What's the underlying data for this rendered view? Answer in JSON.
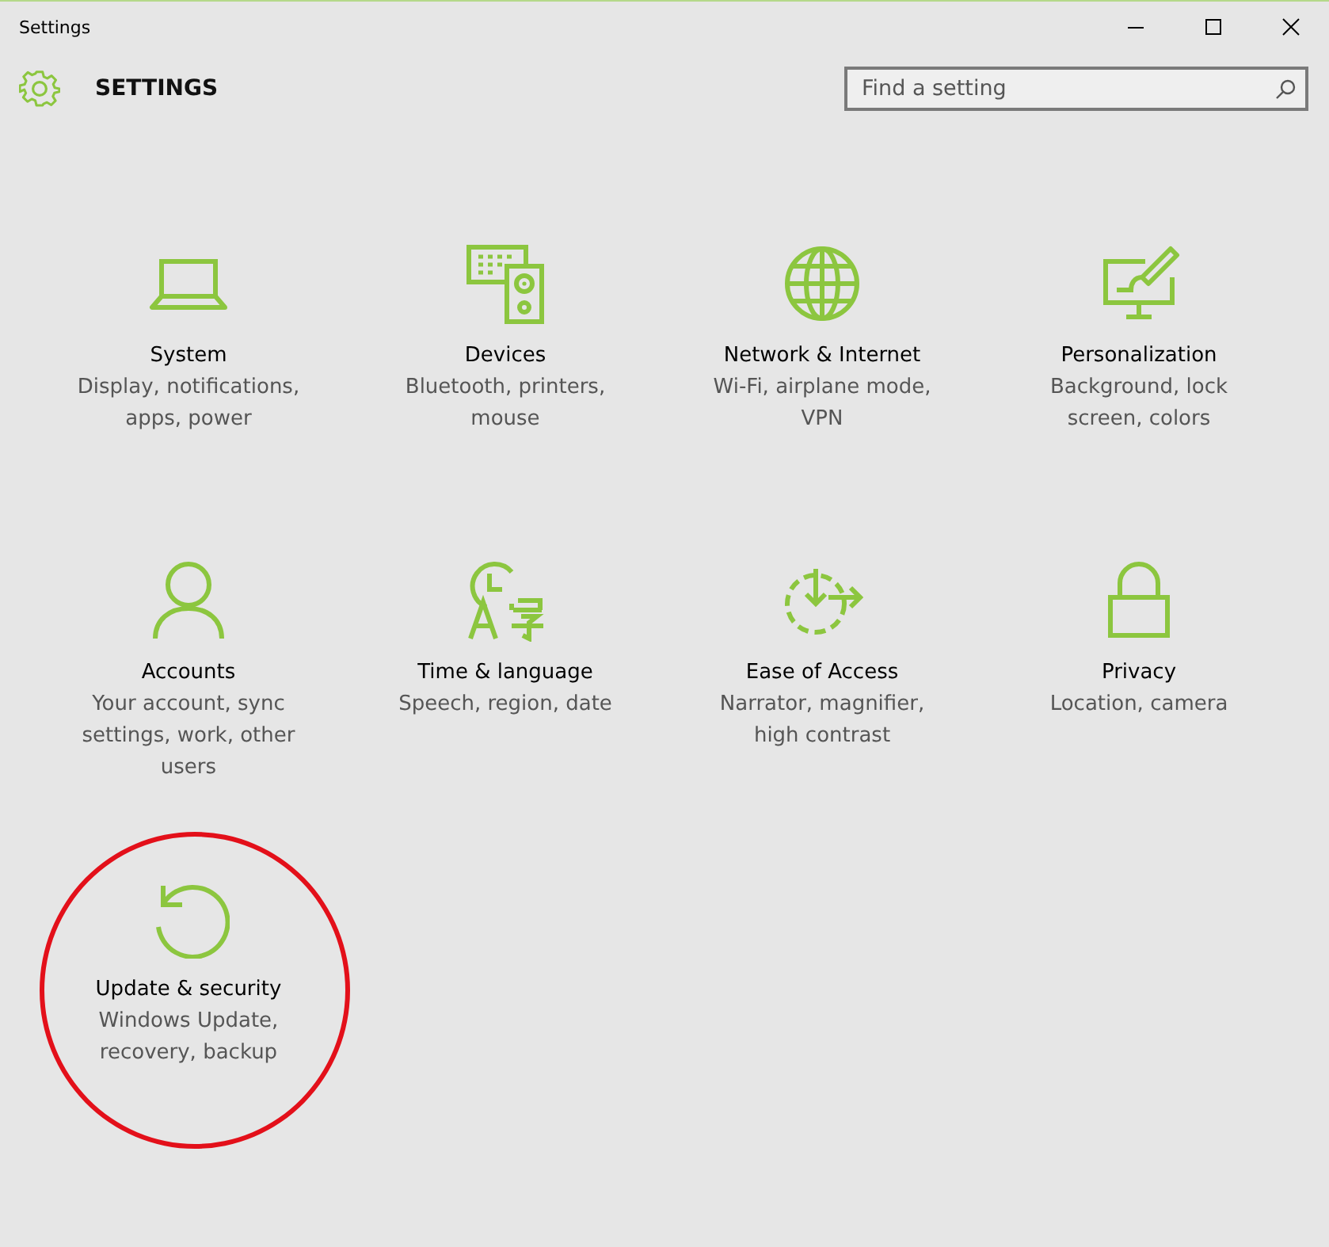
{
  "window": {
    "title": "Settings"
  },
  "header": {
    "title": "SETTINGS"
  },
  "search": {
    "placeholder": "Find a setting"
  },
  "categories": [
    {
      "kind": "laptop",
      "title": "System",
      "description": "Display, notifications, apps, power",
      "highlighted": false
    },
    {
      "kind": "devices",
      "title": "Devices",
      "description": "Bluetooth, printers, mouse",
      "highlighted": false
    },
    {
      "kind": "globe",
      "title": "Network & Internet",
      "description": "Wi-Fi, airplane mode, VPN",
      "highlighted": false
    },
    {
      "kind": "paint",
      "title": "Personalization",
      "description": "Background, lock screen, colors",
      "highlighted": false
    },
    {
      "kind": "person",
      "title": "Accounts",
      "description": "Your account, sync settings, work, other users",
      "highlighted": false
    },
    {
      "kind": "time",
      "title": "Time & language",
      "description": "Speech, region, date",
      "highlighted": false
    },
    {
      "kind": "ease",
      "title": "Ease of Access",
      "description": "Narrator, magnifier, high contrast",
      "highlighted": false
    },
    {
      "kind": "lock",
      "title": "Privacy",
      "description": "Location, camera",
      "highlighted": false
    },
    {
      "kind": "update",
      "title": "Update & security",
      "description": "Windows Update, recovery, backup",
      "highlighted": true
    }
  ]
}
